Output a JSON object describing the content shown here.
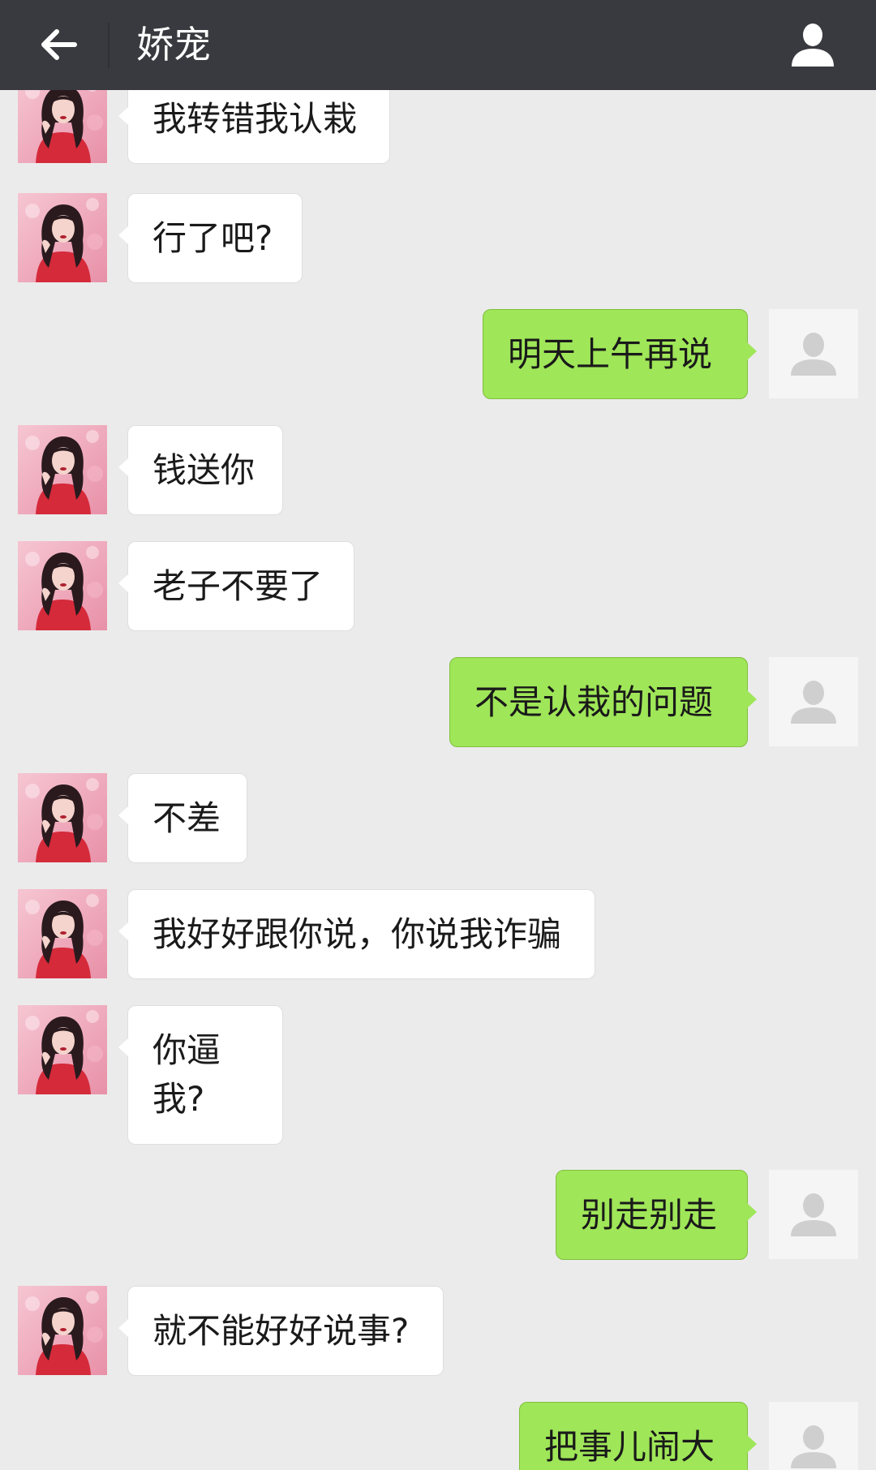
{
  "header": {
    "back_icon": "arrow-left-icon",
    "title": "娇宠",
    "profile_icon": "person-icon",
    "background": "#393a3f"
  },
  "colors": {
    "chat_background": "#ebebeb",
    "incoming_bubble": "#ffffff",
    "outgoing_bubble": "#9fe658"
  },
  "messages": [
    {
      "side": "left",
      "text": "我转错我认栽"
    },
    {
      "side": "left",
      "text": "行了吧?"
    },
    {
      "side": "right",
      "text": "明天上午再说"
    },
    {
      "side": "left",
      "text": "钱送你"
    },
    {
      "side": "left",
      "text": "老子不要了"
    },
    {
      "side": "right",
      "text": "不是认栽的问题"
    },
    {
      "side": "left",
      "text": "不差"
    },
    {
      "side": "left",
      "text": "我好好跟你说，你说我诈骗"
    },
    {
      "side": "left",
      "text": "你逼我?"
    },
    {
      "side": "right",
      "text": "别走别走"
    },
    {
      "side": "left",
      "text": "就不能好好说事?"
    },
    {
      "side": "right",
      "text": "把事儿闹大"
    }
  ]
}
